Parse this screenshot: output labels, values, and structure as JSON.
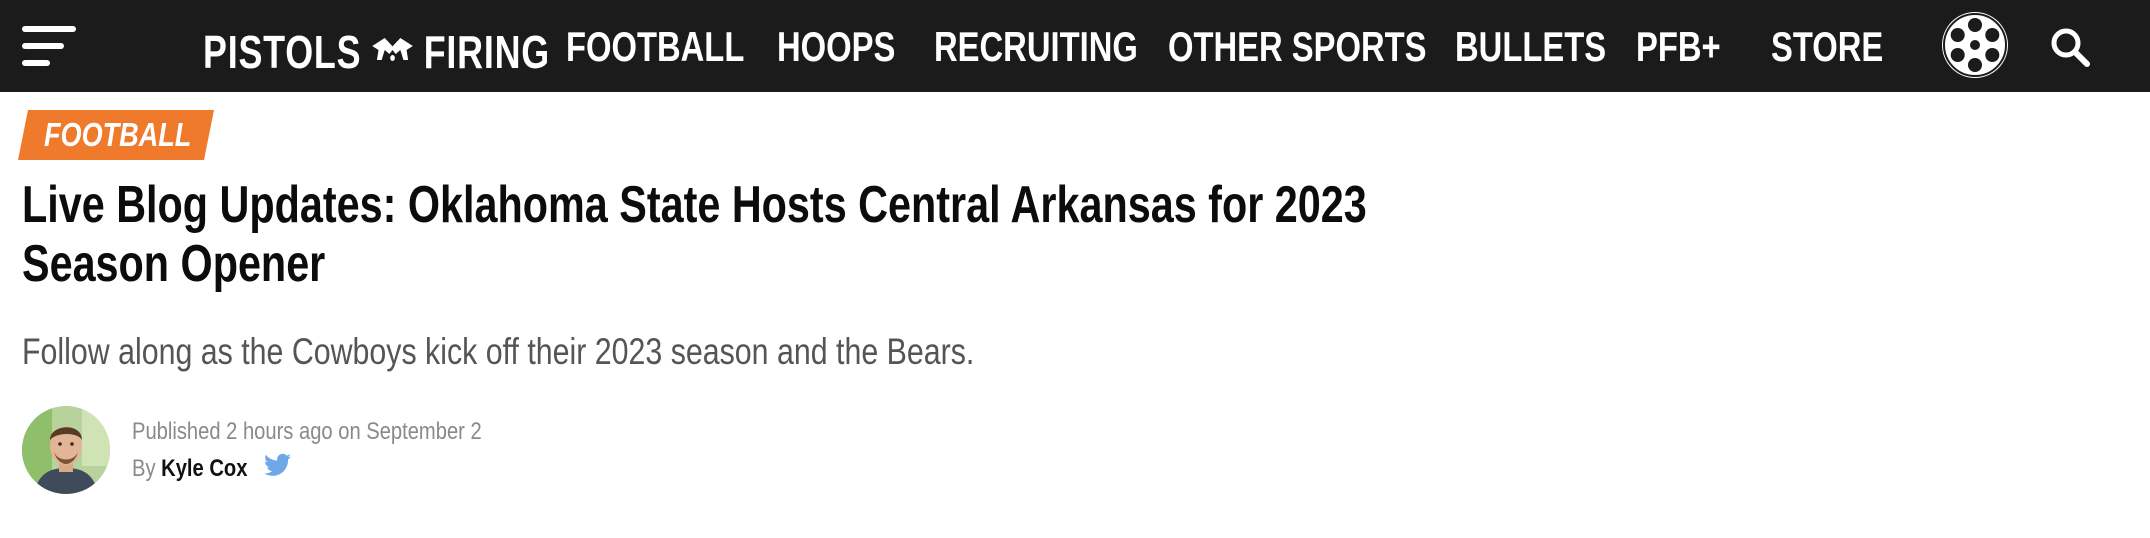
{
  "nav": {
    "logo_left": "PISTOLS",
    "logo_right": "FIRING",
    "items": [
      {
        "label": "FOOTBALL"
      },
      {
        "label": "HOOPS"
      },
      {
        "label": "RECRUITING"
      },
      {
        "label": "OTHER SPORTS"
      },
      {
        "label": "BULLETS"
      },
      {
        "label": "PFB+"
      },
      {
        "label": "STORE"
      }
    ],
    "icons": [
      "menu-icon",
      "crossed-pistols-icon",
      "revolver-cylinder-icon",
      "search-icon"
    ],
    "background_color": "#1b1b1b"
  },
  "article": {
    "category": "FOOTBALL",
    "category_color": "#f07a2c",
    "headline": "Live Blog Updates: Oklahoma State Hosts Central Arkansas for 2023 Season Opener",
    "subheadline": "Follow along as the Cowboys kick off their 2023 season and the Bears.",
    "published": "Published 2 hours ago on September 2",
    "by_prefix": "By",
    "author": "Kyle Cox",
    "social_icon": "twitter-icon",
    "social_color": "#6fa8e8"
  }
}
